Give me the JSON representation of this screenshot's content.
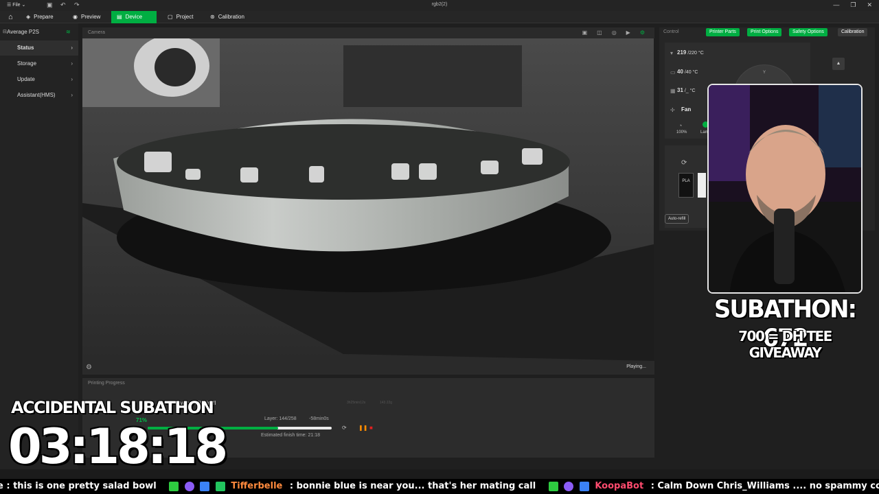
{
  "window": {
    "menu_label": "File",
    "title": "rgb2(2)",
    "controls": [
      "—",
      "❐",
      "✕"
    ]
  },
  "nav": {
    "tabs": [
      {
        "label": "Prepare",
        "icon": "cube-icon"
      },
      {
        "label": "Preview",
        "icon": "eye-icon"
      },
      {
        "label": "Device",
        "icon": "printer-icon",
        "active": true
      },
      {
        "label": "Project",
        "icon": "project-icon"
      },
      {
        "label": "Calibration",
        "icon": "calibration-icon"
      }
    ]
  },
  "sidebar": {
    "printer_name": "Average P2S",
    "items": [
      {
        "label": "Status",
        "active": true
      },
      {
        "label": "Storage"
      },
      {
        "label": "Update"
      },
      {
        "label": "Assistant(HMS)"
      }
    ]
  },
  "camera": {
    "header": "Camera",
    "status": "Playing..."
  },
  "progress": {
    "header": "Printing Progress",
    "description": "walls, 15% infill",
    "faint_values": [
      "3h25min12s",
      "143.22g"
    ],
    "percent_label": "71%",
    "percent": 71,
    "layer": "Layer: 144/258",
    "remaining": "-58min0s",
    "finish_time": "Estimated finish time: 21:18"
  },
  "control": {
    "header": "Control",
    "buttons": [
      "Printer Parts",
      "Print Options",
      "Safety Options",
      "Calibration"
    ],
    "nozzle": {
      "current": "219",
      "target": "/220",
      "unit": "°C"
    },
    "bed": {
      "current": "40",
      "target": "/40",
      "unit": "°C"
    },
    "chamber": {
      "current": "31",
      "target": "/_",
      "unit": "°C"
    },
    "fan_label": "Fan",
    "fan_pct": "100%",
    "lamp_label": "Lamp",
    "jog_label": "Y",
    "ams_slot": "PLA",
    "auto_refill": "Auto-refill"
  },
  "overlay": {
    "subathon_count": "SUBATHON: 672",
    "giveaway": "700 = DH TEE GIVEAWAY",
    "accidental_title": "ACCIDENTAL SUBATHON",
    "timer": "03:18:18"
  },
  "chat": [
    {
      "user": "",
      "text": "e : this is one pretty salad bowl",
      "user_color": "#ffffff"
    },
    {
      "user": "Tifferbelle",
      "text": ": bonnie blue is near you... that's her mating call",
      "user_color": "#ff8a3d"
    },
    {
      "user": "KoopaBot",
      "text": ": Calm Down Chris_Williams .... no spammy commands please",
      "user_color": "#ff4b6e"
    }
  ],
  "colors": {
    "accent": "#00ae42",
    "chat_badge_green": "#2ecc40",
    "chat_badge_blue": "#3b82f6",
    "chat_badge_purple": "#8b5cf6"
  }
}
